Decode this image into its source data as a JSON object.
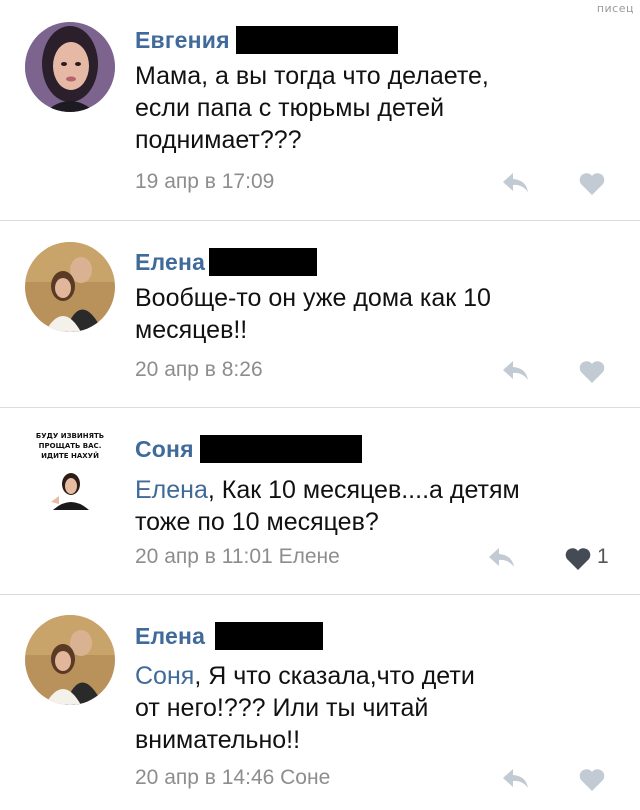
{
  "watermark": "писец",
  "comments": [
    {
      "author": "Евгения",
      "mention": "",
      "text": "Мама, а вы тогда что делаете, если папа с тюрьмы детей поднимает???",
      "lines": [
        "Мама, а вы тогда что делаете,",
        "если папа с тюрьмы детей",
        "поднимает???"
      ],
      "meta": "19 апр в 17:09",
      "likes": "",
      "liked": false
    },
    {
      "author": "Елена",
      "mention": "",
      "lines": [
        "Вообще-то он уже дома как 10",
        "месяцев!!"
      ],
      "meta": "20 апр в 8:26",
      "likes": "",
      "liked": false
    },
    {
      "author": "Соня",
      "mention": "Елена",
      "lines": [
        ", Как 10 месяцев....а детям",
        "тоже по 10 месяцев?"
      ],
      "meta": "20 апр в 11:01 Елене",
      "likes": "1",
      "liked": true,
      "avatar_caption": [
        "БУДУ ИЗВИНЯТЬ",
        "ПРОЩАТЬ ВАС.",
        "ИДИТЕ НАХУЙ"
      ]
    },
    {
      "author": "Елена",
      "mention": "Соня",
      "lines": [
        ", Я что сказала,что дети",
        "от него!??? Или ты читай",
        "внимательно!!"
      ],
      "meta": "20 апр в 14:46 Соне",
      "likes": "",
      "liked": false
    }
  ],
  "colors": {
    "author": "#3f6a99",
    "meta": "#8d8d8d",
    "icon": "#c2cad4",
    "liked_icon": "#454b55"
  },
  "icons": [
    "reply-arrow-icon",
    "heart-icon"
  ]
}
